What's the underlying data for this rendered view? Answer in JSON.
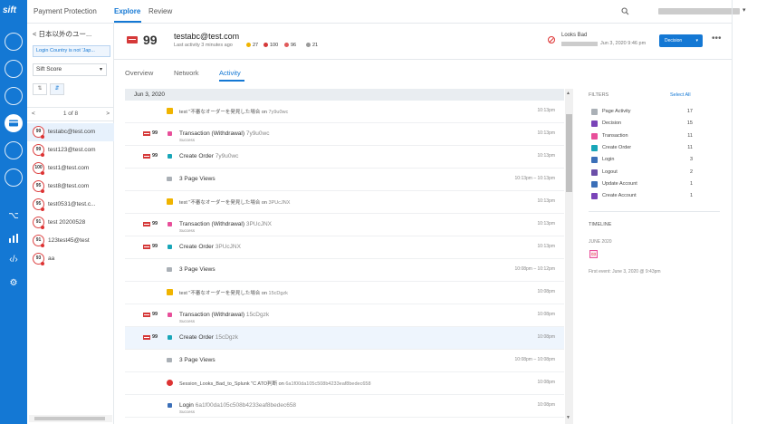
{
  "app": {
    "logo_text": "sift",
    "nav": {
      "primary": "Payment Protection",
      "explore": "Explore",
      "review": "Review"
    },
    "colors": {
      "brand": "#1478d4",
      "danger": "#d53939",
      "warning": "#f0b400"
    }
  },
  "rail_icons": [
    "user-icon",
    "bulb-icon",
    "document-icon",
    "card-icon",
    "globe-icon",
    "chat-icon",
    "workflow-icon",
    "bar-chart-icon",
    "code-icon",
    "gear-icon"
  ],
  "list": {
    "header": "< 日本以外のユー...",
    "filter_chip": "Login Country is not 'Jap...",
    "sort_label": "Sift Score",
    "pager": "1 of 8",
    "pager_prev": "<",
    "pager_next": ">",
    "users": [
      {
        "score": "99",
        "name": "testabc@test.com",
        "selected": true
      },
      {
        "score": "99",
        "name": "test123@test.com",
        "selected": false
      },
      {
        "score": "100",
        "name": "test1@test.com",
        "selected": false
      },
      {
        "score": "95",
        "name": "test8@test.com",
        "selected": false
      },
      {
        "score": "95",
        "name": "test0531@test.c...",
        "selected": false
      },
      {
        "score": "91",
        "name": "test 20200528",
        "selected": false
      },
      {
        "score": "91",
        "name": "123test45@test",
        "selected": false
      },
      {
        "score": "93",
        "name": "aa",
        "selected": false
      }
    ]
  },
  "user": {
    "score": "99",
    "email": "testabc@test.com",
    "last_activity": "Last activity 3 minutes ago",
    "counts": [
      {
        "value": "27",
        "color": "#f0b400"
      },
      {
        "value": "100",
        "color": "#d53939"
      },
      {
        "value": "96",
        "color": "#e05a5a"
      },
      {
        "value": "21",
        "color": "#999999"
      }
    ],
    "decision_status": "Looks Bad",
    "decision_date": "Jun 3, 2020 9:46 pm",
    "decision_button": "Decision",
    "decision_caret": "▾",
    "more": "•••"
  },
  "tabs": [
    {
      "label": "Overview",
      "active": false
    },
    {
      "label": "Network",
      "active": false
    },
    {
      "label": "Activity",
      "active": true
    }
  ],
  "activity": {
    "date_header": "Jun 3, 2020",
    "rows": [
      {
        "score": "",
        "icon": "warn",
        "text": "test \"不審なオーダーを発見した場合 on",
        "ref": "7y9u0wc",
        "sub": "",
        "time": "10:13pm",
        "highlight": false
      },
      {
        "score": "99",
        "icon": "pink",
        "text": "Transaction (Withdrawal)",
        "ref": "7y9u0wc",
        "sub": "Success",
        "time": "10:13pm",
        "highlight": false
      },
      {
        "score": "99",
        "icon": "teal",
        "text": "Create Order",
        "ref": "7y9u0wc",
        "sub": "",
        "time": "10:13pm",
        "highlight": false
      },
      {
        "score": "",
        "icon": "gray",
        "text": "3 Page Views",
        "ref": "",
        "sub": "",
        "time": "10:13pm – 10:13pm",
        "highlight": false
      },
      {
        "score": "",
        "icon": "warn",
        "text": "test \"不審なオーダーを発見した場合 on",
        "ref": "3PUcJNX",
        "sub": "",
        "time": "10:13pm",
        "highlight": false
      },
      {
        "score": "99",
        "icon": "pink",
        "text": "Transaction (Withdrawal)",
        "ref": "3PUcJNX",
        "sub": "Success",
        "time": "10:13pm",
        "highlight": false
      },
      {
        "score": "99",
        "icon": "teal",
        "text": "Create Order",
        "ref": "3PUcJNX",
        "sub": "",
        "time": "10:13pm",
        "highlight": false
      },
      {
        "score": "",
        "icon": "gray",
        "text": "3 Page Views",
        "ref": "",
        "sub": "",
        "time": "10:08pm – 10:12pm",
        "highlight": false
      },
      {
        "score": "",
        "icon": "warn",
        "text": "test \"不審なオーダーを発見した場合 on",
        "ref": "15cDgzk",
        "sub": "",
        "time": "10:08pm",
        "highlight": false
      },
      {
        "score": "99",
        "icon": "pink",
        "text": "Transaction (Withdrawal)",
        "ref": "15cDgzk",
        "sub": "Success",
        "time": "10:08pm",
        "highlight": false
      },
      {
        "score": "99",
        "icon": "teal",
        "text": "Create Order",
        "ref": "15cDgzk",
        "sub": "",
        "time": "10:08pm",
        "highlight": true
      },
      {
        "score": "",
        "icon": "gray",
        "text": "3 Page Views",
        "ref": "",
        "sub": "",
        "time": "10:08pm – 10:08pm",
        "highlight": false
      },
      {
        "score": "",
        "icon": "stop",
        "text": "Session_Looks_Bad_to_Splunk \"C ATO判断 on",
        "ref": "6a1f00da105c508b4233eaf8bedec658",
        "sub": "",
        "time": "10:08pm",
        "highlight": false
      },
      {
        "score": "",
        "icon": "blue",
        "text": "Login",
        "ref": "6a1f00da105c508b4233eaf8bedec658",
        "sub": "Success",
        "time": "10:08pm",
        "highlight": false
      }
    ]
  },
  "filters": {
    "header": "FILTERS",
    "select_all": "Select All",
    "items": [
      {
        "label": "Page Activity",
        "count": "17",
        "color": "#aab0b6"
      },
      {
        "label": "Decision",
        "count": "15",
        "color": "#7a44b8"
      },
      {
        "label": "Transaction",
        "count": "11",
        "color": "#e84f9a"
      },
      {
        "label": "Create Order",
        "count": "11",
        "color": "#18a6b8"
      },
      {
        "label": "Login",
        "count": "3",
        "color": "#3b6fb8"
      },
      {
        "label": "Logout",
        "count": "2",
        "color": "#6b4fa8"
      },
      {
        "label": "Update Account",
        "count": "1",
        "color": "#3b6fb8"
      },
      {
        "label": "Create Account",
        "count": "1",
        "color": "#7a44b8"
      }
    ]
  },
  "timeline": {
    "header": "TIMELINE",
    "month": "JUNE 2020",
    "marker": "03",
    "first_event": "First event: June 3, 2020 @ 9:43pm"
  }
}
